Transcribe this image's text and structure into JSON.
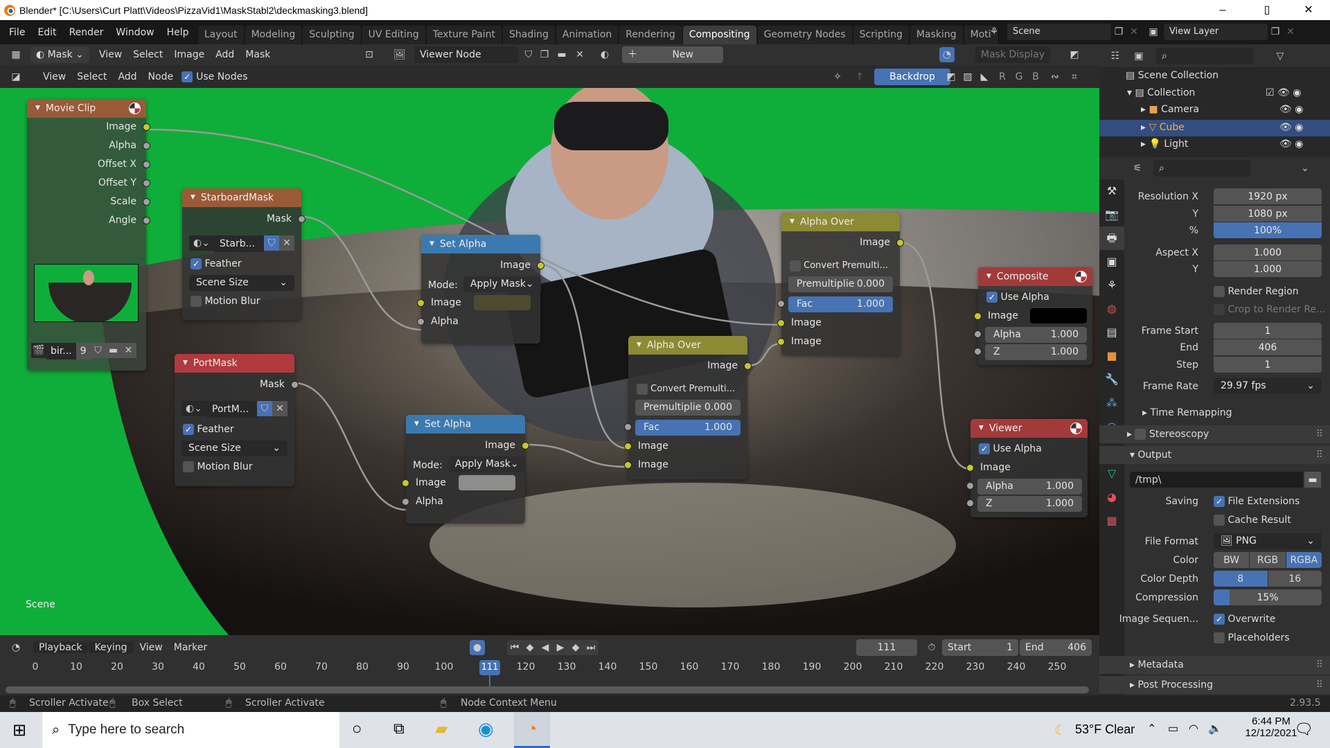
{
  "window": {
    "title": "Blender* [C:\\Users\\Curt Platt\\Videos\\PizzaVid1\\MaskStabl2\\deckmasking3.blend]",
    "minimize": "–",
    "maximize": "▯",
    "close": "✕"
  },
  "menu": [
    "File",
    "Edit",
    "Render",
    "Window",
    "Help"
  ],
  "workspaces": [
    "Layout",
    "Modeling",
    "Sculpting",
    "UV Editing",
    "Texture Paint",
    "Shading",
    "Animation",
    "Rendering",
    "Compositing",
    "Geometry Nodes",
    "Scripting",
    "Masking",
    "Moti"
  ],
  "active_workspace": "Compositing",
  "scene": "Scene",
  "view_layer": "View Layer",
  "image_header": {
    "mode": "Mask",
    "menus": [
      "View",
      "Select",
      "Image",
      "Add",
      "Mask"
    ],
    "image": "Viewer Node",
    "new": "New",
    "mask_display": "Mask Display"
  },
  "node_header": {
    "menus": [
      "View",
      "Select",
      "Add",
      "Node"
    ],
    "use_nodes": "Use Nodes",
    "use_nodes_checked": true,
    "backdrop": "Backdrop",
    "channels": [
      "R",
      "G",
      "B"
    ]
  },
  "canvas_label": "Scene",
  "nodes": {
    "movie_clip": {
      "title": "Movie Clip",
      "outputs": [
        "Image",
        "Alpha",
        "Offset X",
        "Offset Y",
        "Scale",
        "Angle"
      ],
      "clip": "bir...",
      "users": "9"
    },
    "starboard": {
      "title": "StarboardMask",
      "output": "Mask",
      "mask": "Starb...",
      "feather": "Feather",
      "size": "Scene Size",
      "motion_blur": "Motion Blur"
    },
    "port": {
      "title": "PortMask",
      "output": "Mask",
      "mask": "PortM...",
      "feather": "Feather",
      "size": "Scene Size",
      "motion_blur": "Motion Blur"
    },
    "set_alpha_1": {
      "title": "Set Alpha",
      "output": "Image",
      "mode_label": "Mode:",
      "mode": "Apply Mask",
      "in_image": "Image",
      "in_alpha": "Alpha"
    },
    "set_alpha_2": {
      "title": "Set Alpha",
      "output": "Image",
      "mode_label": "Mode:",
      "mode": "Apply Mask",
      "in_image": "Image",
      "in_alpha": "Alpha"
    },
    "alpha_over_1": {
      "title": "Alpha Over",
      "output": "Image",
      "convert": "Convert Premulti...",
      "premul_label": "Premultiplie",
      "premul": "0.000",
      "fac_label": "Fac",
      "fac": "1.000",
      "in1": "Image",
      "in2": "Image"
    },
    "alpha_over_2": {
      "title": "Alpha Over",
      "output": "Image",
      "convert": "Convert Premulti...",
      "premul_label": "Premultiplie",
      "premul": "0.000",
      "fac_label": "Fac",
      "fac": "1.000",
      "in1": "Image",
      "in2": "Image"
    },
    "composite": {
      "title": "Composite",
      "use_alpha": "Use Alpha",
      "in_image": "Image",
      "alpha_label": "Alpha",
      "alpha": "1.000",
      "z_label": "Z",
      "z": "1.000"
    },
    "viewer": {
      "title": "Viewer",
      "use_alpha": "Use Alpha",
      "in_image": "Image",
      "alpha_label": "Alpha",
      "alpha": "1.000",
      "z_label": "Z",
      "z": "1.000"
    }
  },
  "outliner": {
    "root": "Scene Collection",
    "items": [
      {
        "name": "Collection"
      },
      {
        "name": "Camera"
      },
      {
        "name": "Cube",
        "selected": true
      },
      {
        "name": "Light"
      }
    ]
  },
  "properties": {
    "res_x_label": "Resolution X",
    "res_x": "1920 px",
    "res_y_label": "Y",
    "res_y": "1080 px",
    "pct_label": "%",
    "pct": "100%",
    "aspect_x_label": "Aspect X",
    "aspect_x": "1.000",
    "aspect_y_label": "Y",
    "aspect_y": "1.000",
    "render_region": "Render Region",
    "crop": "Crop to Render Re...",
    "frame_start_label": "Frame Start",
    "frame_start": "1",
    "end_label": "End",
    "end": "406",
    "step_label": "Step",
    "step": "1",
    "frame_rate_label": "Frame Rate",
    "frame_rate": "29.97 fps",
    "time_remapping": "Time Remapping",
    "stereoscopy": "Stereoscopy",
    "output": "Output",
    "path": "/tmp\\",
    "saving_label": "Saving",
    "file_extensions": "File Extensions",
    "cache_result": "Cache Result",
    "file_format_label": "File Format",
    "file_format": "PNG",
    "color_label": "Color",
    "color_opts": [
      "BW",
      "RGB",
      "RGBA"
    ],
    "color_active": "RGBA",
    "depth_label": "Color Depth",
    "depth_opts": [
      "8",
      "16"
    ],
    "depth_active": "8",
    "compression_label": "Compression",
    "compression": "15%",
    "compression_value": 15,
    "imgseq_label": "Image Sequen...",
    "overwrite": "Overwrite",
    "placeholders": "Placeholders",
    "metadata": "Metadata",
    "post_processing": "Post Processing"
  },
  "version": "2.93.5",
  "timeline": {
    "menus": [
      "Playback",
      "Keying",
      "View",
      "Marker"
    ],
    "current": "111",
    "start_label": "Start",
    "start": "1",
    "end_label": "End",
    "end": "406",
    "ticks": [
      0,
      10,
      20,
      30,
      40,
      50,
      60,
      70,
      80,
      90,
      100,
      120,
      130,
      140,
      150,
      160,
      170,
      180,
      190,
      200,
      210,
      220,
      230,
      240,
      250
    ]
  },
  "status": [
    "Scroller Activate",
    "Box Select",
    "Scroller Activate",
    "Node Context Menu"
  ],
  "taskbar": {
    "search": "Type here to search",
    "weather": "53°F Clear",
    "time": "6:44 PM",
    "date": "12/12/2021"
  },
  "colors": {
    "accent": "#4772b3",
    "canvas_green": "#0fae3a",
    "socket_image": "#c7c729",
    "socket_value": "#a1a1a1"
  }
}
